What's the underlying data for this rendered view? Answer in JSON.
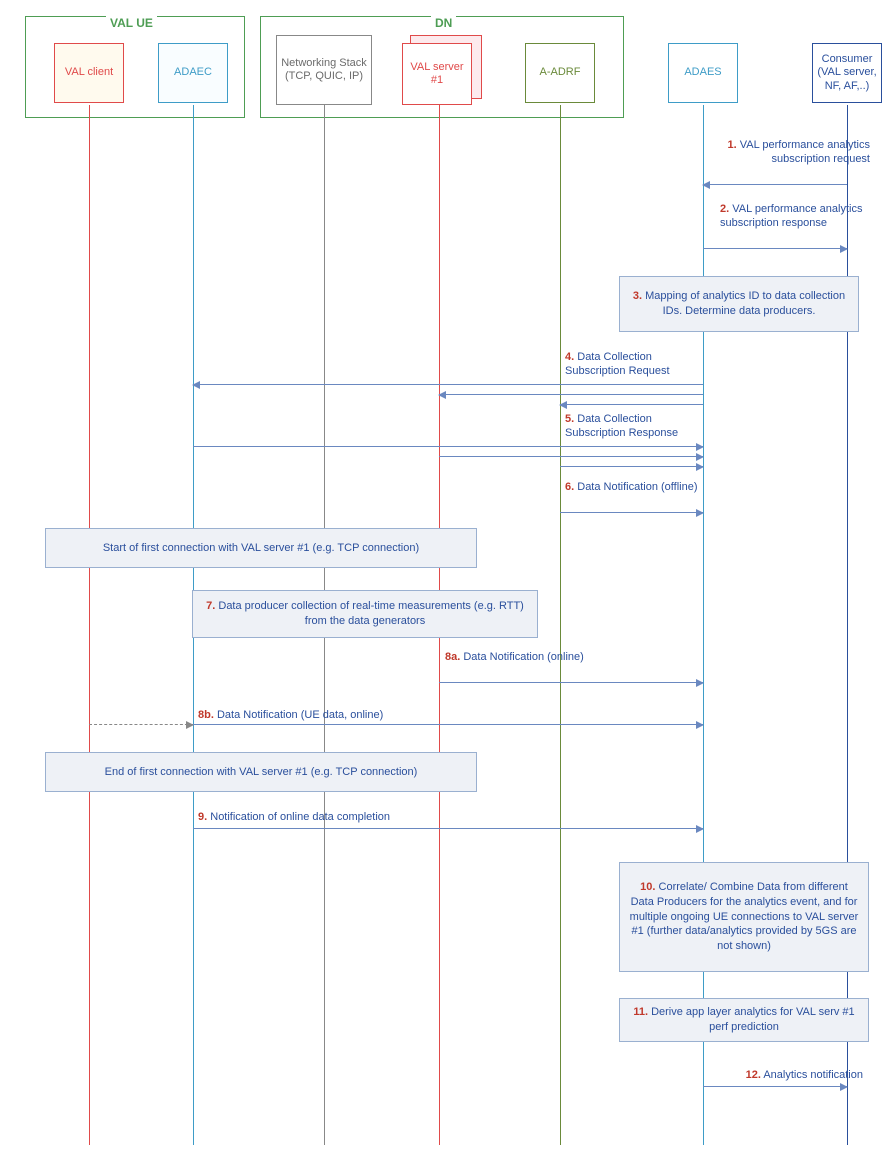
{
  "groups": {
    "val_ue": "VAL UE",
    "dn": "DN"
  },
  "actors": {
    "val_client": "VAL client",
    "adaec": "ADAEC",
    "netstack": "Networking Stack (TCP, QUIC, IP)",
    "val_server": "VAL server #1",
    "aadrf": "A-ADRF",
    "adaes": "ADAES",
    "consumer": "Consumer (VAL server, NF, AF,..)"
  },
  "messages": {
    "m1": {
      "num": "1.",
      "text": "VAL performance analytics subscription request"
    },
    "m2": {
      "num": "2.",
      "text": "VAL performance analytics subscription response"
    },
    "m3": {
      "num": "3.",
      "text": "Mapping of analytics ID to data collection IDs. Determine data producers."
    },
    "m4": {
      "num": "4.",
      "text": "Data Collection Subscription Request"
    },
    "m5": {
      "num": "5.",
      "text": "Data Collection Subscription Response"
    },
    "m6": {
      "num": "6.",
      "text": "Data Notification (offline)"
    },
    "n_start": "Start of first connection with VAL server #1 (e.g. TCP connection)",
    "m7": {
      "num": "7.",
      "text": "Data producer collection of real-time measurements (e.g. RTT) from the data generators"
    },
    "m8a": {
      "num": "8a.",
      "text": "Data Notification (online)"
    },
    "m8b": {
      "num": "8b.",
      "text": "Data Notification (UE data, online)"
    },
    "n_end": "End of first connection with VAL server #1 (e.g. TCP connection)",
    "m9": {
      "num": "9.",
      "text": "Notification of online data completion"
    },
    "m10": {
      "num": "10.",
      "text": "Correlate/ Combine Data from different Data Producers for the analytics event, and for multiple ongoing UE connections to VAL server #1 (further data/analytics provided by 5GS are not shown)"
    },
    "m11": {
      "num": "11.",
      "text": "Derive app layer analytics for VAL serv #1 perf prediction"
    },
    "m12": {
      "num": "12.",
      "text": "Analytics notification"
    }
  }
}
